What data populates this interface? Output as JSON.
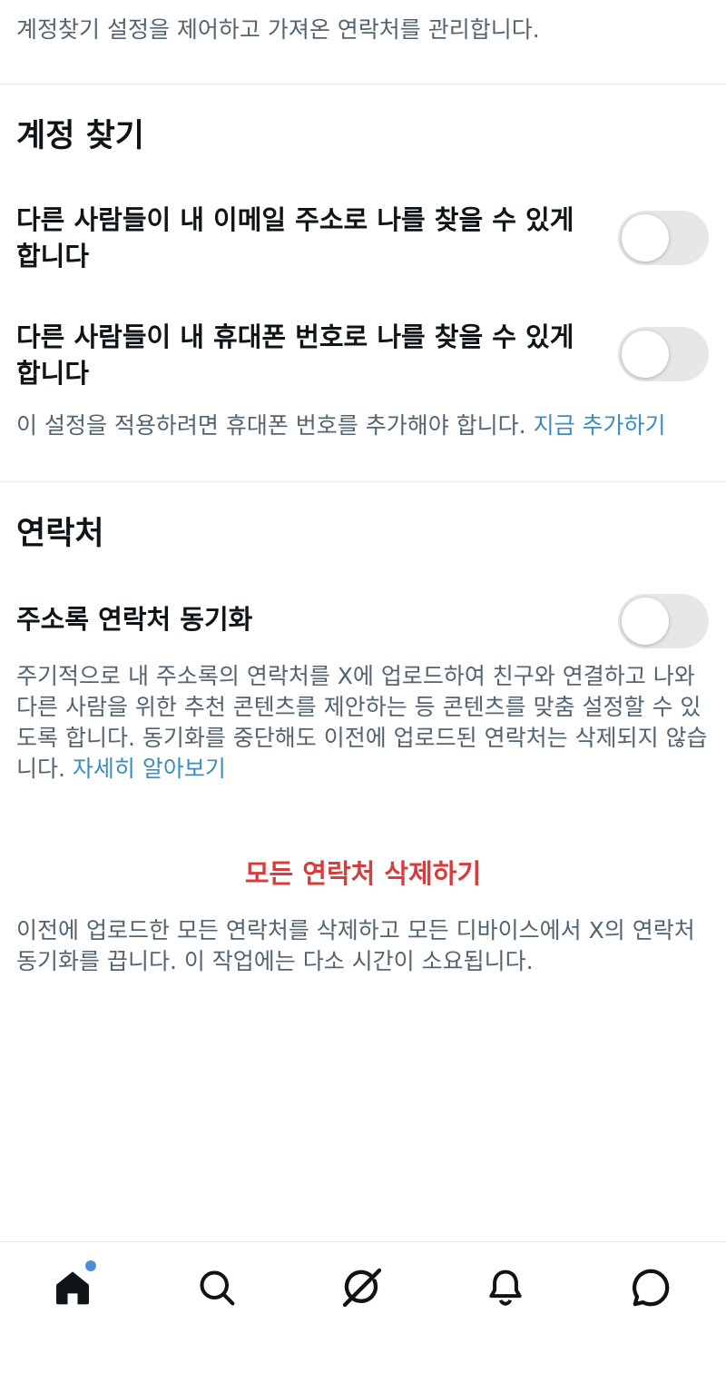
{
  "intro": {
    "text": "계정찾기 설정을 제어하고 가져온 연락처를 관리합니다."
  },
  "discoverability": {
    "title": "계정 찾기",
    "email_label": "다른 사람들이 내 이메일 주소로 나를 찾을 수 있게 합니다",
    "email_enabled": false,
    "phone_label": "다른 사람들이 내 휴대폰 번호로 나를 찾을 수 있게 합니다",
    "phone_enabled": false,
    "phone_help": "이 설정을 적용하려면 휴대폰 번호를 추가해야 합니다. ",
    "phone_help_link": "지금 추가하기"
  },
  "contacts": {
    "title": "연락처",
    "sync_label": "주소록 연락처 동기화",
    "sync_enabled": false,
    "sync_help": "주기적으로 내 주소록의 연락처를 X에 업로드하여 친구와 연결하고 나와 다른 사람을 위한 추천 콘텐츠를 제안하는 등 콘텐츠를 맞춤 설정할 수 있도록 합니다. 동기화를 중단해도 이전에 업로드된 연락처는 삭제되지 않습니다. ",
    "sync_help_link": "자세히 알아보기",
    "delete_label": "모든 연락처 삭제하기",
    "delete_help": "이전에 업로드한 모든 연락처를 삭제하고 모든 디바이스에서 X의 연락처 동기화를 끕니다. 이 작업에는 다소 시간이 소요됩니다."
  },
  "bottom_nav": {
    "items": [
      {
        "icon": "home-icon",
        "active": true,
        "has_notification_dot": true
      },
      {
        "icon": "search-icon",
        "active": false
      },
      {
        "icon": "grok-icon",
        "active": false
      },
      {
        "icon": "bell-icon",
        "active": false
      },
      {
        "icon": "messages-icon",
        "active": false
      }
    ]
  },
  "colors": {
    "text_primary": "#0f1419",
    "text_secondary": "#536471",
    "link": "#3c8dbc",
    "danger": "#d63d3d",
    "toggle_off": "#e7e7e7",
    "divider": "#e7e9ea",
    "notification_dot": "#4a90d9"
  }
}
